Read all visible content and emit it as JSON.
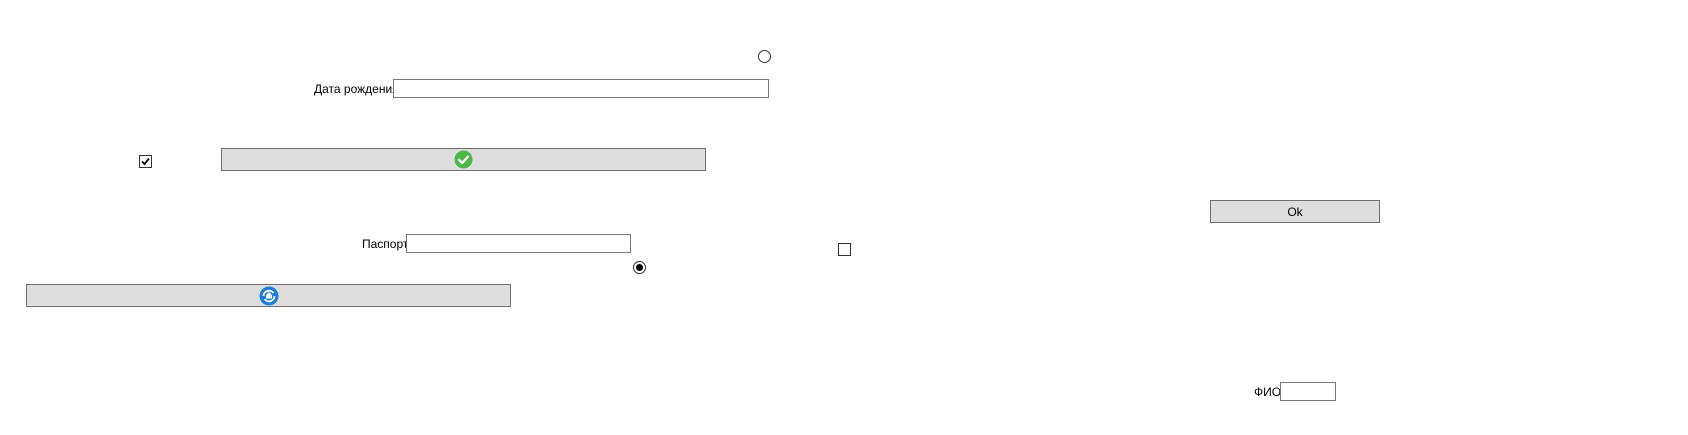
{
  "form": {
    "radio_top": {
      "checked": false
    },
    "birth_date": {
      "label": "Дата рождения",
      "value": ""
    },
    "agree_checkbox": {
      "checked": true
    },
    "confirm_button": {
      "icon": "green-check-circle-icon",
      "icon_color": "#4cb848"
    },
    "ok_button": {
      "label": "Ok"
    },
    "passport": {
      "label": "Паспорт",
      "value": ""
    },
    "checkbox_middle": {
      "checked": false
    },
    "radio_bottom": {
      "checked": true
    },
    "update_button": {
      "icon": "blue-refresh-icon",
      "icon_color": "#1c7cd6"
    },
    "fio": {
      "label": "ФИО",
      "value": ""
    }
  }
}
